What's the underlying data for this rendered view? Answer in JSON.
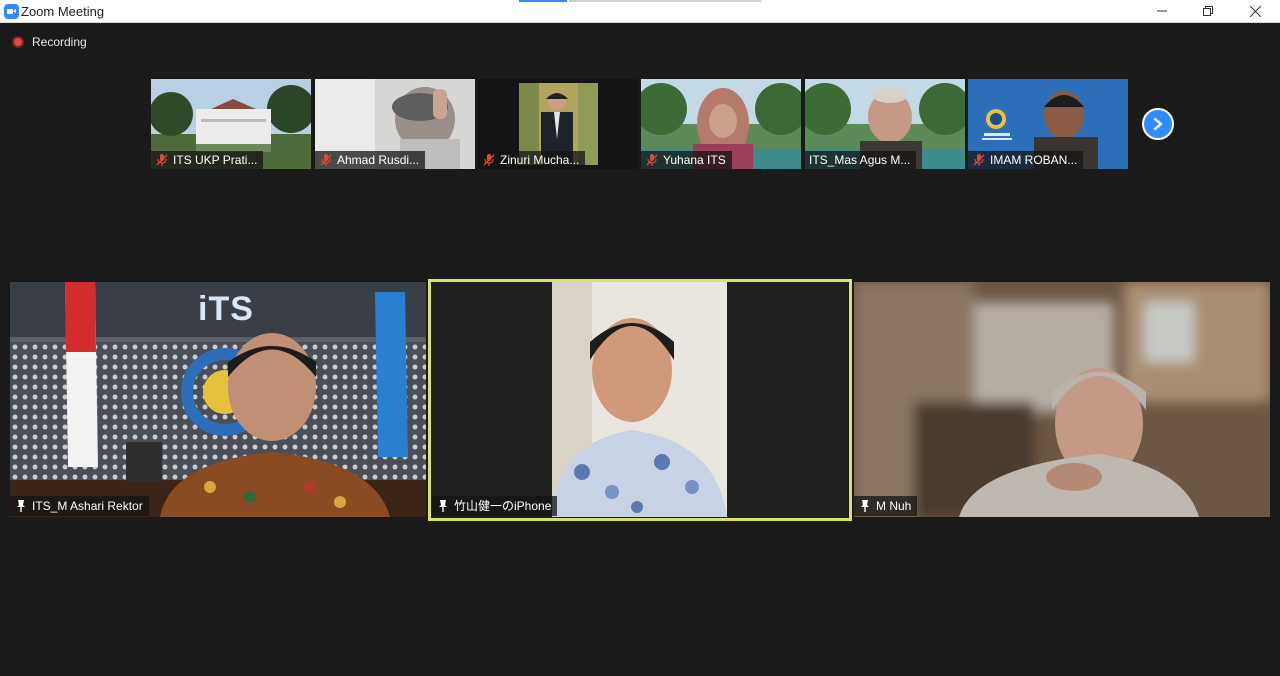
{
  "window": {
    "title": "Zoom Meeting",
    "controls": {
      "minimize": "—",
      "restore": "❐",
      "close": "✕"
    }
  },
  "recording": {
    "label": "Recording"
  },
  "thumbnails": [
    {
      "name": "ITS UKP Prati...",
      "audio": "muted"
    },
    {
      "name": "Ahmad Rusdi...",
      "audio": "muted"
    },
    {
      "name": "Zinuri Mucha...",
      "audio": "muted"
    },
    {
      "name": "Yuhana ITS",
      "audio": "muted"
    },
    {
      "name": "ITS_Mas Agus M...",
      "audio": "unmuted"
    },
    {
      "name": "IMAM ROBAN...",
      "audio": "muted"
    }
  ],
  "next_page": {
    "icon": "chevron-right-icon"
  },
  "main_tiles": [
    {
      "name": "ITS_M Ashari Rektor",
      "pinned": true,
      "background_text": "iTS"
    },
    {
      "name": "竹山健一のiPhone",
      "pinned": true,
      "active_speaker": true
    },
    {
      "name": "M Nuh",
      "pinned": true
    }
  ],
  "colors": {
    "background": "#1a1a1a",
    "active_speaker_border": "#d8e36a",
    "accent": "#2d8cff",
    "recording": "#e5473d",
    "mute": "#e0463c"
  }
}
